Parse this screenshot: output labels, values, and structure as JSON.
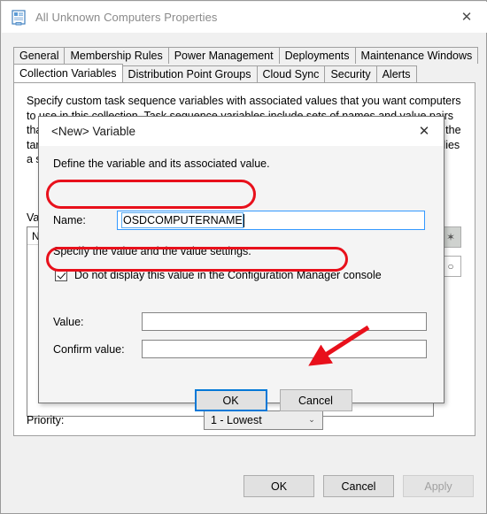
{
  "window": {
    "title": "All Unknown Computers Properties",
    "icon": "properties-document-icon",
    "close_label": "✕"
  },
  "tabs": {
    "row1": [
      {
        "label": "General",
        "selected": false
      },
      {
        "label": "Membership Rules",
        "selected": false
      },
      {
        "label": "Power Management",
        "selected": false
      },
      {
        "label": "Deployments",
        "selected": false
      },
      {
        "label": "Maintenance Windows",
        "selected": false
      }
    ],
    "row2": [
      {
        "label": "Collection Variables",
        "selected": true
      },
      {
        "label": "Distribution Point Groups",
        "selected": false
      },
      {
        "label": "Cloud Sync",
        "selected": false
      },
      {
        "label": "Security",
        "selected": false
      },
      {
        "label": "Alerts",
        "selected": false
      }
    ]
  },
  "panel": {
    "description": "Specify custom task sequence variables with associated values that you want computers to use in this collection. Task sequence variables include sets of names and value pairs that supply configuration settings and other operating system deployment settings for the target computer. You can also start the task sequence with a command-line that supplies a set of variables for the task sequence to use.",
    "variables_label": "Variables",
    "list_header": "Name",
    "list_row": "",
    "list_buttons": [
      {
        "name": "new-variable-button",
        "glyph": "✶"
      },
      {
        "name": "delete-variable-button",
        "glyph": "○"
      }
    ],
    "priority_label": "Priority:",
    "priority_value": "1 - Lowest",
    "priority_caret": "⌄"
  },
  "footer": {
    "ok": "OK",
    "cancel": "Cancel",
    "apply": "Apply"
  },
  "modal": {
    "title": "<New> Variable",
    "close_label": "✕",
    "intro": "Define the variable and its associated value.",
    "name_label": "Name:",
    "name_value": "OSDCOMPUTERNAME",
    "name_placeholder": "",
    "value_settings_text": "Specify the value and the value settings.",
    "hide_value_checkbox_label": "Do not display this value in the Configuration Manager console",
    "hide_value_checked": true,
    "value_label": "Value:",
    "value_value": "",
    "value_placeholder": "",
    "confirm_label": "Confirm value:",
    "confirm_value": "",
    "confirm_placeholder": "",
    "ok": "OK",
    "cancel": "Cancel"
  },
  "annotations": {
    "accent_color": "#e8101b",
    "focus_color": "#0078d7",
    "highlight_name_field": true,
    "highlight_checkbox": true,
    "arrow_points_to": "OK"
  }
}
